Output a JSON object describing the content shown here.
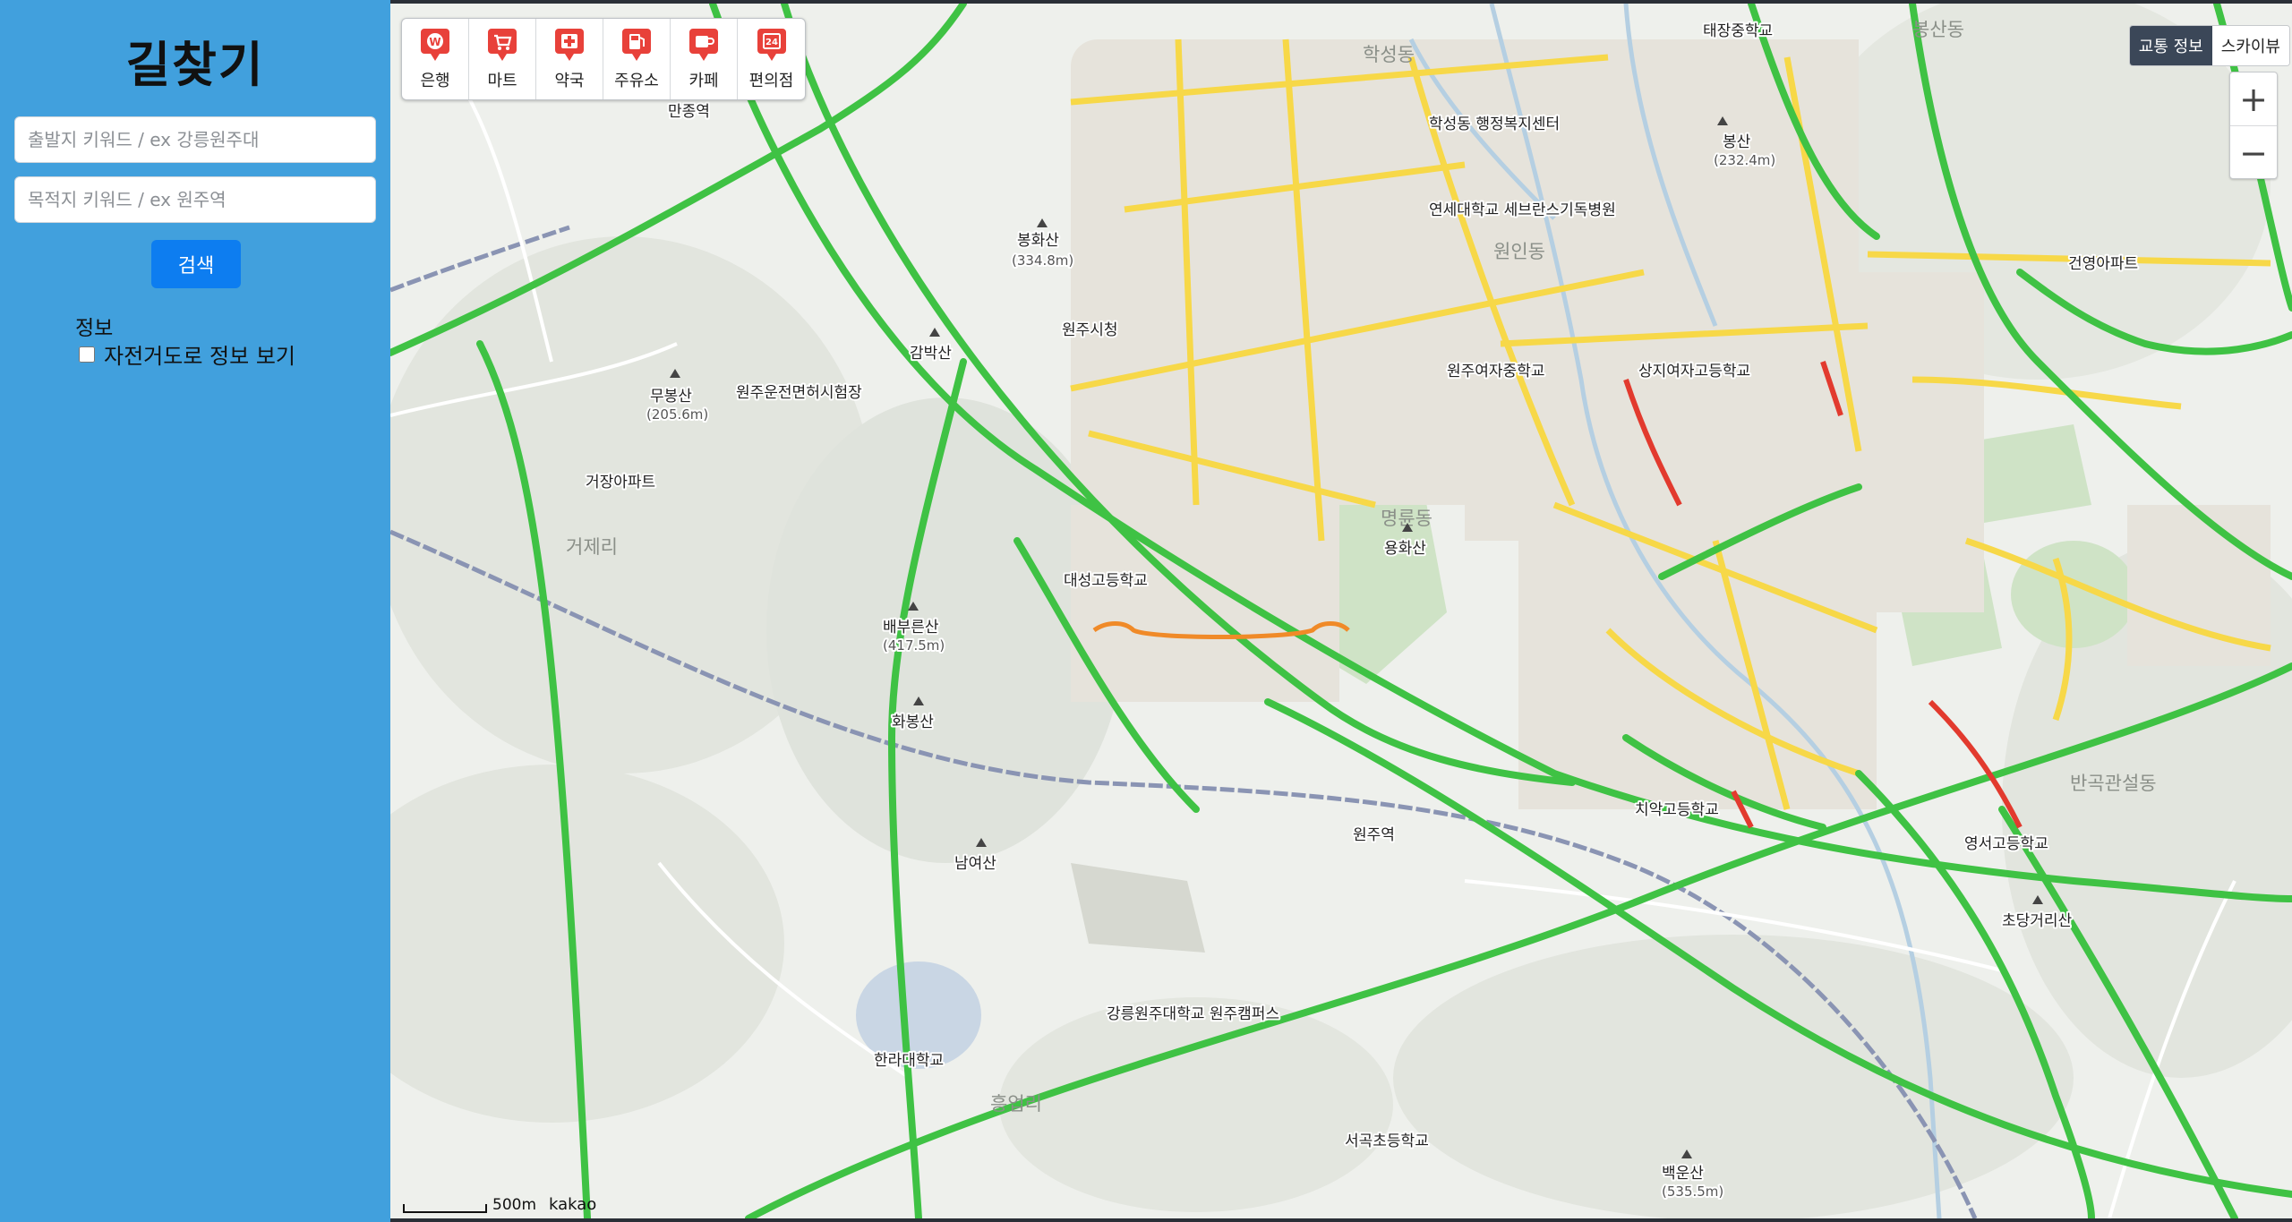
{
  "sidebar": {
    "title": "길찾기",
    "start_placeholder": "출발지 키워드 / ex 강릉원주대",
    "dest_placeholder": "목적지 키워드 / ex 원주역",
    "search_label": "검색",
    "info_title": "정보",
    "bike_label": "자전거도로 정보 보기",
    "bike_checked": false
  },
  "map": {
    "categories": [
      {
        "label": "은행",
        "icon": "bank-icon"
      },
      {
        "label": "마트",
        "icon": "cart-icon"
      },
      {
        "label": "약국",
        "icon": "pharmacy-icon"
      },
      {
        "label": "주유소",
        "icon": "gas-station-icon"
      },
      {
        "label": "카페",
        "icon": "coffee-icon"
      },
      {
        "label": "편의점",
        "icon": "convenience-store-icon"
      }
    ],
    "map_type": {
      "traffic": "교통 정보",
      "skyview": "스카이뷰"
    },
    "zoom": {
      "in": "+",
      "out": "−"
    },
    "scale_text": "500m",
    "logo": "kakao",
    "places": {
      "wonju_station": "원주역",
      "wonju_city_hall": "원주시청",
      "bonghwasan": "봉화산",
      "bonghwasan_h": "(334.8m)",
      "gambaksan": "감박산",
      "mubongsan": "무봉산",
      "mubongsan_h": "(205.6m)",
      "baebureunsan": "배부른산",
      "baebureunsan_h": "(417.5m)",
      "hwabongsan": "화봉산",
      "namyeosan": "남여산",
      "yonghwasan": "용화산",
      "bongsan": "봉산",
      "bongsan_h": "(232.4m)",
      "baegunsan": "백운산",
      "baegunsan_h": "(535.5m)",
      "chodanggeorisan": "초당거리산",
      "manjongyeok": "만종역",
      "license_center": "원주운전면허시험장",
      "geojang_apt": "거장아파트",
      "daeseong_hs": "대성고등학교",
      "hanra_univ": "한라대학교",
      "gwu_campus": "강릉원주대학교 원주캠퍼스",
      "yonsei_hospital": "연세대학교 세브란스기독병원",
      "wonju_girls_ms": "원주여자중학교",
      "chiak_hs": "치악고등학교",
      "yeongseo_hs": "영서고등학교",
      "taejang_ms": "태장중학교",
      "seogok_es": "서곡초등학교",
      "hakseong_center": "학성동 행정복지센터",
      "geonyeong_apt": "건영아파트",
      "sanggji_girls_hs": "상지여자고등학교",
      "area_gwanseol": "반곡관설동",
      "area_heungeop": "흥업리",
      "area_geojeri": "거제리",
      "area_bongsandong": "봉산동",
      "area_wondong": "원인동",
      "area_myeongnyun": "명륜동",
      "area_hakseong": "학성동"
    }
  }
}
